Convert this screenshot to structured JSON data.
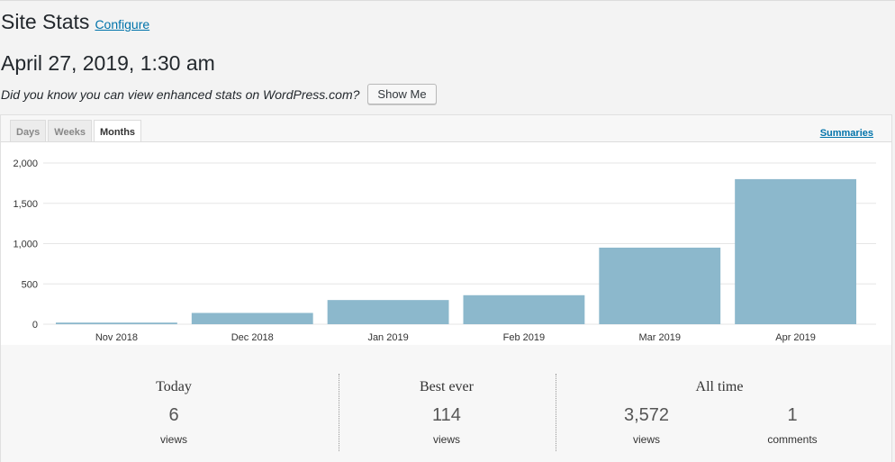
{
  "header": {
    "title": "Site Stats",
    "configure_label": "Configure"
  },
  "date": "April 27, 2019, 1:30 am",
  "promo": {
    "text": "Did you know you can view enhanced stats on WordPress.com?",
    "button_label": "Show Me"
  },
  "tabs": [
    {
      "label": "Days",
      "active": false
    },
    {
      "label": "Weeks",
      "active": false
    },
    {
      "label": "Months",
      "active": true
    }
  ],
  "summaries_label": "Summaries",
  "colors": {
    "bar": "#8cb8cc",
    "grid": "#e6e6e6",
    "link": "#0073aa"
  },
  "chart_data": {
    "type": "bar",
    "categories": [
      "Nov 2018",
      "Dec 2018",
      "Jan 2019",
      "Feb 2019",
      "Mar 2019",
      "Apr 2019"
    ],
    "values": [
      20,
      140,
      300,
      360,
      950,
      1800
    ],
    "yticks": [
      "0",
      "500",
      "1,000",
      "1,500",
      "2,000"
    ],
    "ytick_values": [
      0,
      500,
      1000,
      1500,
      2000
    ],
    "ylim": [
      0,
      2000
    ],
    "grid": true
  },
  "summary": {
    "today": {
      "heading": "Today",
      "value": "6",
      "unit": "views"
    },
    "best_ever": {
      "heading": "Best ever",
      "value": "114",
      "unit": "views"
    },
    "all_time": {
      "heading": "All time",
      "views_value": "3,572",
      "views_unit": "views",
      "comments_value": "1",
      "comments_unit": "comments"
    }
  }
}
